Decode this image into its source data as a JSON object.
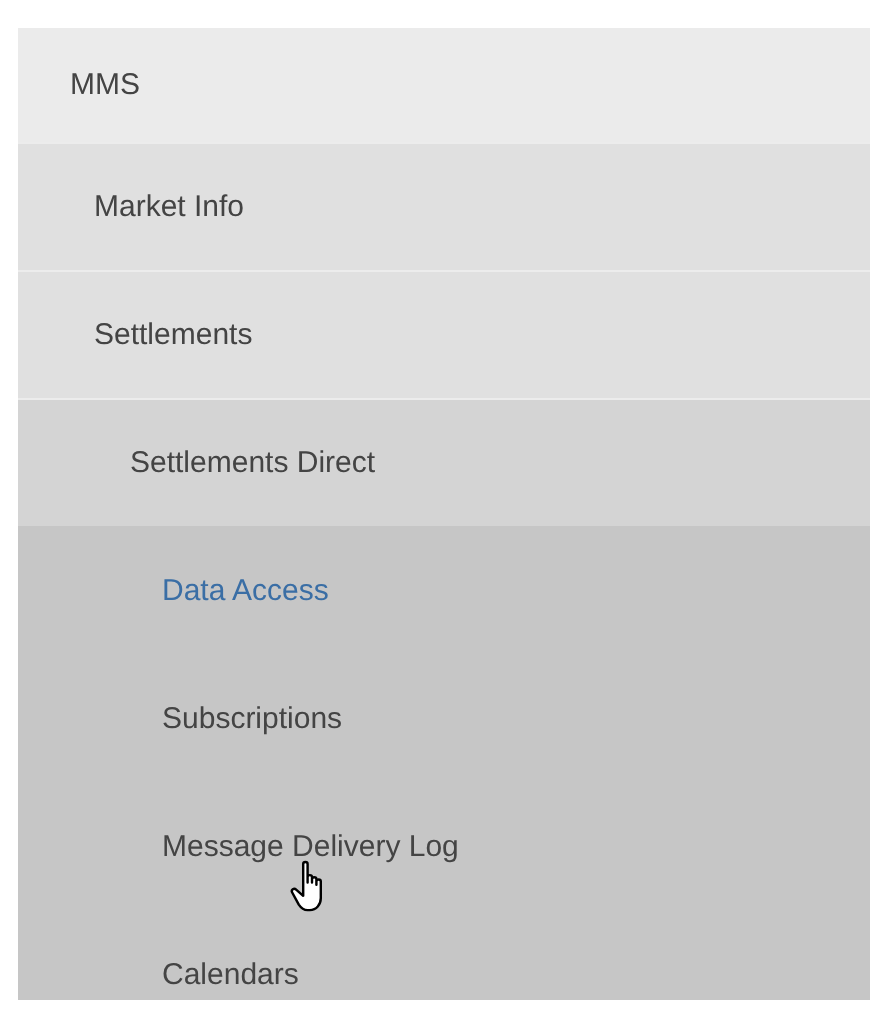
{
  "menu": {
    "label": "MMS",
    "selected": false,
    "children": [
      {
        "label": "Market Info",
        "selected": false
      },
      {
        "label": "Settlements",
        "selected": false,
        "children": [
          {
            "label": "Settlements Direct",
            "selected": false,
            "children": [
              {
                "label": "Data Access",
                "selected": true
              },
              {
                "label": "Subscriptions",
                "selected": false
              },
              {
                "label": "Message Delivery Log",
                "selected": false
              },
              {
                "label": "Calendars",
                "selected": false
              }
            ]
          }
        ]
      }
    ]
  }
}
